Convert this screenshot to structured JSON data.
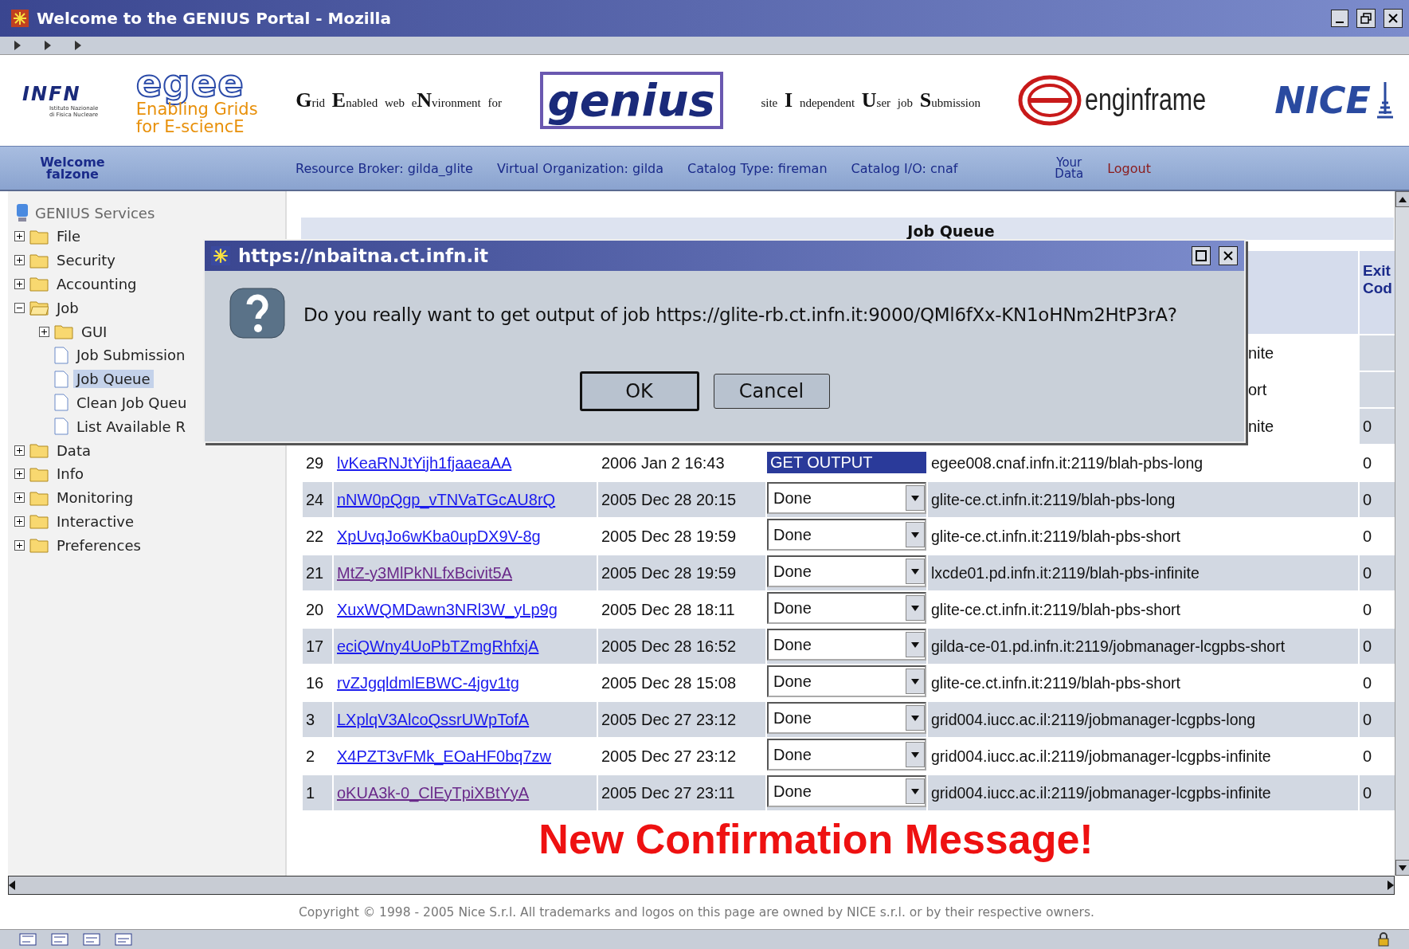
{
  "window": {
    "title": "Welcome to the GENIUS Portal - Mozilla"
  },
  "banner": {
    "infn": {
      "name": "INFN",
      "subtitle": [
        "Istituto Nazionale",
        "di Fisica Nucleare"
      ]
    },
    "egee": {
      "name": "egee",
      "tagline": [
        "Enabling Grids",
        "for E-sciencE"
      ]
    },
    "genius_expansion": "**G**rid **E**nabled web e**N**vironment for",
    "genius": "genius",
    "ius_expansion": "site **I** ndependent **U**ser job **S**ubmission",
    "enginframe": "enginframe",
    "nice": "NICE"
  },
  "navbar": {
    "welcome": [
      "Welcome",
      "falzone"
    ],
    "items": [
      "Resource Broker: gilda_glite",
      "Virtual Organization: gilda",
      "Catalog Type: fireman",
      "Catalog I/O: cnaf"
    ],
    "your_data": [
      "Your",
      "Data"
    ],
    "logout": "Logout"
  },
  "sidebar": {
    "title": "GENIUS Services",
    "items": [
      {
        "label": "File",
        "kind": "folder",
        "expanded": false,
        "selected": false
      },
      {
        "label": "Security",
        "kind": "folder",
        "expanded": false,
        "selected": false
      },
      {
        "label": "Accounting",
        "kind": "folder",
        "expanded": false,
        "selected": false
      },
      {
        "label": "Job",
        "kind": "folder",
        "expanded": true,
        "selected": false,
        "children": [
          {
            "label": "GUI",
            "kind": "folder",
            "expanded": false,
            "selected": false
          },
          {
            "label": "Job Submission",
            "kind": "page",
            "selected": false
          },
          {
            "label": "Job Queue",
            "kind": "page",
            "selected": true
          },
          {
            "label": "Clean Job Queu",
            "kind": "page",
            "selected": false
          },
          {
            "label": "List Available R",
            "kind": "page",
            "selected": false
          }
        ]
      },
      {
        "label": "Data",
        "kind": "folder",
        "expanded": false,
        "selected": false
      },
      {
        "label": "Info",
        "kind": "folder",
        "expanded": false,
        "selected": false
      },
      {
        "label": "Monitoring",
        "kind": "folder",
        "expanded": false,
        "selected": false
      },
      {
        "label": "Interactive",
        "kind": "folder",
        "expanded": false,
        "selected": false
      },
      {
        "label": "Preferences",
        "kind": "folder",
        "expanded": false,
        "selected": false
      }
    ]
  },
  "table": {
    "heading": "Job Queue",
    "exit_header": [
      "Exit",
      "Cod"
    ],
    "partial_rows": [
      {
        "ce": "nite"
      },
      {
        "ce": "ort"
      },
      {
        "ce": "nite",
        "exit": "0"
      }
    ],
    "rows": [
      {
        "num": "29",
        "job_id": "lvKeaRNJtYijh1fjaaeaAA",
        "visited": false,
        "submitted": "2006 Jan 2 16:43",
        "menu": [
          {
            "label": "GET OUTPUT",
            "selected": true
          }
        ],
        "ce": "egee008.cnaf.infn.it:2119/blah-pbs-long",
        "exit": "0"
      },
      {
        "num": "24",
        "job_id": "nNW0pQgp_vTNVaTGcAU8rQ",
        "visited": false,
        "submitted": "2005 Dec 28 20:15",
        "status": "Done",
        "ce": "glite-ce.ct.infn.it:2119/blah-pbs-long",
        "exit": "0"
      },
      {
        "num": "22",
        "job_id": "XpUvqJo6wKba0upDX9V-8g",
        "visited": false,
        "submitted": "2005 Dec 28 19:59",
        "status": "Done",
        "ce": "glite-ce.ct.infn.it:2119/blah-pbs-short",
        "exit": "0"
      },
      {
        "num": "21",
        "job_id": "MtZ-y3MlPkNLfxBcivit5A",
        "visited": true,
        "submitted": "2005 Dec 28 19:59",
        "status": "Done",
        "ce": "lxcde01.pd.infn.it:2119/blah-pbs-infinite",
        "exit": "0"
      },
      {
        "num": "20",
        "job_id": "XuxWQMDawn3NRl3W_yLp9g",
        "visited": false,
        "submitted": "2005 Dec 28 18:11",
        "status": "Done",
        "ce": "glite-ce.ct.infn.it:2119/blah-pbs-short",
        "exit": "0"
      },
      {
        "num": "17",
        "job_id": "eciQWny4UoPbTZmgRhfxjA",
        "visited": false,
        "submitted": "2005 Dec 28 16:52",
        "status": "Done",
        "ce": "gilda-ce-01.pd.infn.it:2119/jobmanager-lcgpbs-short",
        "exit": "0"
      },
      {
        "num": "16",
        "job_id": "rvZJgqldmlEBWC-4jgv1tg",
        "visited": false,
        "submitted": "2005 Dec 28 15:08",
        "status": "Done",
        "ce": "glite-ce.ct.infn.it:2119/blah-pbs-short",
        "exit": "0"
      },
      {
        "num": "3",
        "job_id": "LXplqV3AlcoQssrUWpTofA",
        "visited": false,
        "submitted": "2005 Dec 27 23:12",
        "status": "Done",
        "ce": "grid004.iucc.ac.il:2119/jobmanager-lcgpbs-long",
        "exit": "0"
      },
      {
        "num": "2",
        "job_id": "X4PZT3vFMk_EOaHF0bq7zw",
        "visited": false,
        "submitted": "2005 Dec 27 23:12",
        "status": "Done",
        "ce": "grid004.iucc.ac.il:2119/jobmanager-lcgpbs-infinite",
        "exit": "0"
      },
      {
        "num": "1",
        "job_id": "oKUA3k-0_ClEyTpiXBtYyA",
        "visited": true,
        "submitted": "2005 Dec 27 23:11",
        "status": "Done",
        "ce": "grid004.iucc.ac.il:2119/jobmanager-lcgpbs-infinite",
        "exit": "0"
      }
    ]
  },
  "notice": "New Confirmation Message!",
  "dialog": {
    "title": "https://nbaitna.ct.infn.it",
    "message": "Do you really want to get output of job https://glite-rb.ct.infn.it:9000/QMl6fXx-KN1oHNm2HtP3rA?",
    "buttons": [
      {
        "label": "OK",
        "default": true
      },
      {
        "label": "Cancel",
        "default": false
      }
    ]
  },
  "footer": {
    "copyright": "Copyright © 1998 - 2005 Nice S.r.l. All trademarks and logos on this page are owned by NICE s.r.l. or by their respective owners."
  }
}
